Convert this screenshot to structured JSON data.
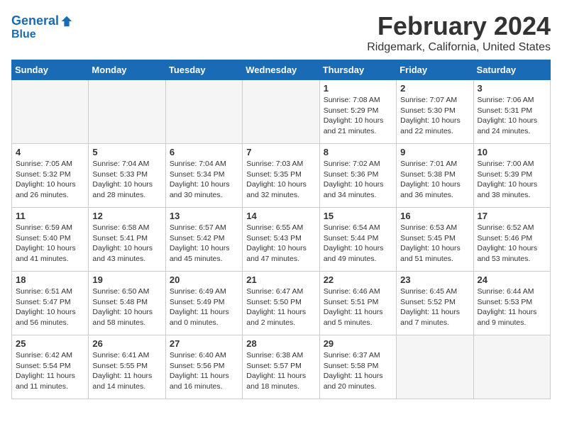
{
  "logo": {
    "line1": "General",
    "line2": "Blue"
  },
  "title": "February 2024",
  "subtitle": "Ridgemark, California, United States",
  "weekdays": [
    "Sunday",
    "Monday",
    "Tuesday",
    "Wednesday",
    "Thursday",
    "Friday",
    "Saturday"
  ],
  "weeks": [
    [
      {
        "day": "",
        "empty": true
      },
      {
        "day": "",
        "empty": true
      },
      {
        "day": "",
        "empty": true
      },
      {
        "day": "",
        "empty": true
      },
      {
        "day": "1",
        "rise": "7:08 AM",
        "set": "5:29 PM",
        "daylight": "10 hours and 21 minutes."
      },
      {
        "day": "2",
        "rise": "7:07 AM",
        "set": "5:30 PM",
        "daylight": "10 hours and 22 minutes."
      },
      {
        "day": "3",
        "rise": "7:06 AM",
        "set": "5:31 PM",
        "daylight": "10 hours and 24 minutes."
      }
    ],
    [
      {
        "day": "4",
        "rise": "7:05 AM",
        "set": "5:32 PM",
        "daylight": "10 hours and 26 minutes."
      },
      {
        "day": "5",
        "rise": "7:04 AM",
        "set": "5:33 PM",
        "daylight": "10 hours and 28 minutes."
      },
      {
        "day": "6",
        "rise": "7:04 AM",
        "set": "5:34 PM",
        "daylight": "10 hours and 30 minutes."
      },
      {
        "day": "7",
        "rise": "7:03 AM",
        "set": "5:35 PM",
        "daylight": "10 hours and 32 minutes."
      },
      {
        "day": "8",
        "rise": "7:02 AM",
        "set": "5:36 PM",
        "daylight": "10 hours and 34 minutes."
      },
      {
        "day": "9",
        "rise": "7:01 AM",
        "set": "5:38 PM",
        "daylight": "10 hours and 36 minutes."
      },
      {
        "day": "10",
        "rise": "7:00 AM",
        "set": "5:39 PM",
        "daylight": "10 hours and 38 minutes."
      }
    ],
    [
      {
        "day": "11",
        "rise": "6:59 AM",
        "set": "5:40 PM",
        "daylight": "10 hours and 41 minutes."
      },
      {
        "day": "12",
        "rise": "6:58 AM",
        "set": "5:41 PM",
        "daylight": "10 hours and 43 minutes."
      },
      {
        "day": "13",
        "rise": "6:57 AM",
        "set": "5:42 PM",
        "daylight": "10 hours and 45 minutes."
      },
      {
        "day": "14",
        "rise": "6:55 AM",
        "set": "5:43 PM",
        "daylight": "10 hours and 47 minutes."
      },
      {
        "day": "15",
        "rise": "6:54 AM",
        "set": "5:44 PM",
        "daylight": "10 hours and 49 minutes."
      },
      {
        "day": "16",
        "rise": "6:53 AM",
        "set": "5:45 PM",
        "daylight": "10 hours and 51 minutes."
      },
      {
        "day": "17",
        "rise": "6:52 AM",
        "set": "5:46 PM",
        "daylight": "10 hours and 53 minutes."
      }
    ],
    [
      {
        "day": "18",
        "rise": "6:51 AM",
        "set": "5:47 PM",
        "daylight": "10 hours and 56 minutes."
      },
      {
        "day": "19",
        "rise": "6:50 AM",
        "set": "5:48 PM",
        "daylight": "10 hours and 58 minutes."
      },
      {
        "day": "20",
        "rise": "6:49 AM",
        "set": "5:49 PM",
        "daylight": "11 hours and 0 minutes."
      },
      {
        "day": "21",
        "rise": "6:47 AM",
        "set": "5:50 PM",
        "daylight": "11 hours and 2 minutes."
      },
      {
        "day": "22",
        "rise": "6:46 AM",
        "set": "5:51 PM",
        "daylight": "11 hours and 5 minutes."
      },
      {
        "day": "23",
        "rise": "6:45 AM",
        "set": "5:52 PM",
        "daylight": "11 hours and 7 minutes."
      },
      {
        "day": "24",
        "rise": "6:44 AM",
        "set": "5:53 PM",
        "daylight": "11 hours and 9 minutes."
      }
    ],
    [
      {
        "day": "25",
        "rise": "6:42 AM",
        "set": "5:54 PM",
        "daylight": "11 hours and 11 minutes."
      },
      {
        "day": "26",
        "rise": "6:41 AM",
        "set": "5:55 PM",
        "daylight": "11 hours and 14 minutes."
      },
      {
        "day": "27",
        "rise": "6:40 AM",
        "set": "5:56 PM",
        "daylight": "11 hours and 16 minutes."
      },
      {
        "day": "28",
        "rise": "6:38 AM",
        "set": "5:57 PM",
        "daylight": "11 hours and 18 minutes."
      },
      {
        "day": "29",
        "rise": "6:37 AM",
        "set": "5:58 PM",
        "daylight": "11 hours and 20 minutes."
      },
      {
        "day": "",
        "empty": true
      },
      {
        "day": "",
        "empty": true
      }
    ]
  ]
}
